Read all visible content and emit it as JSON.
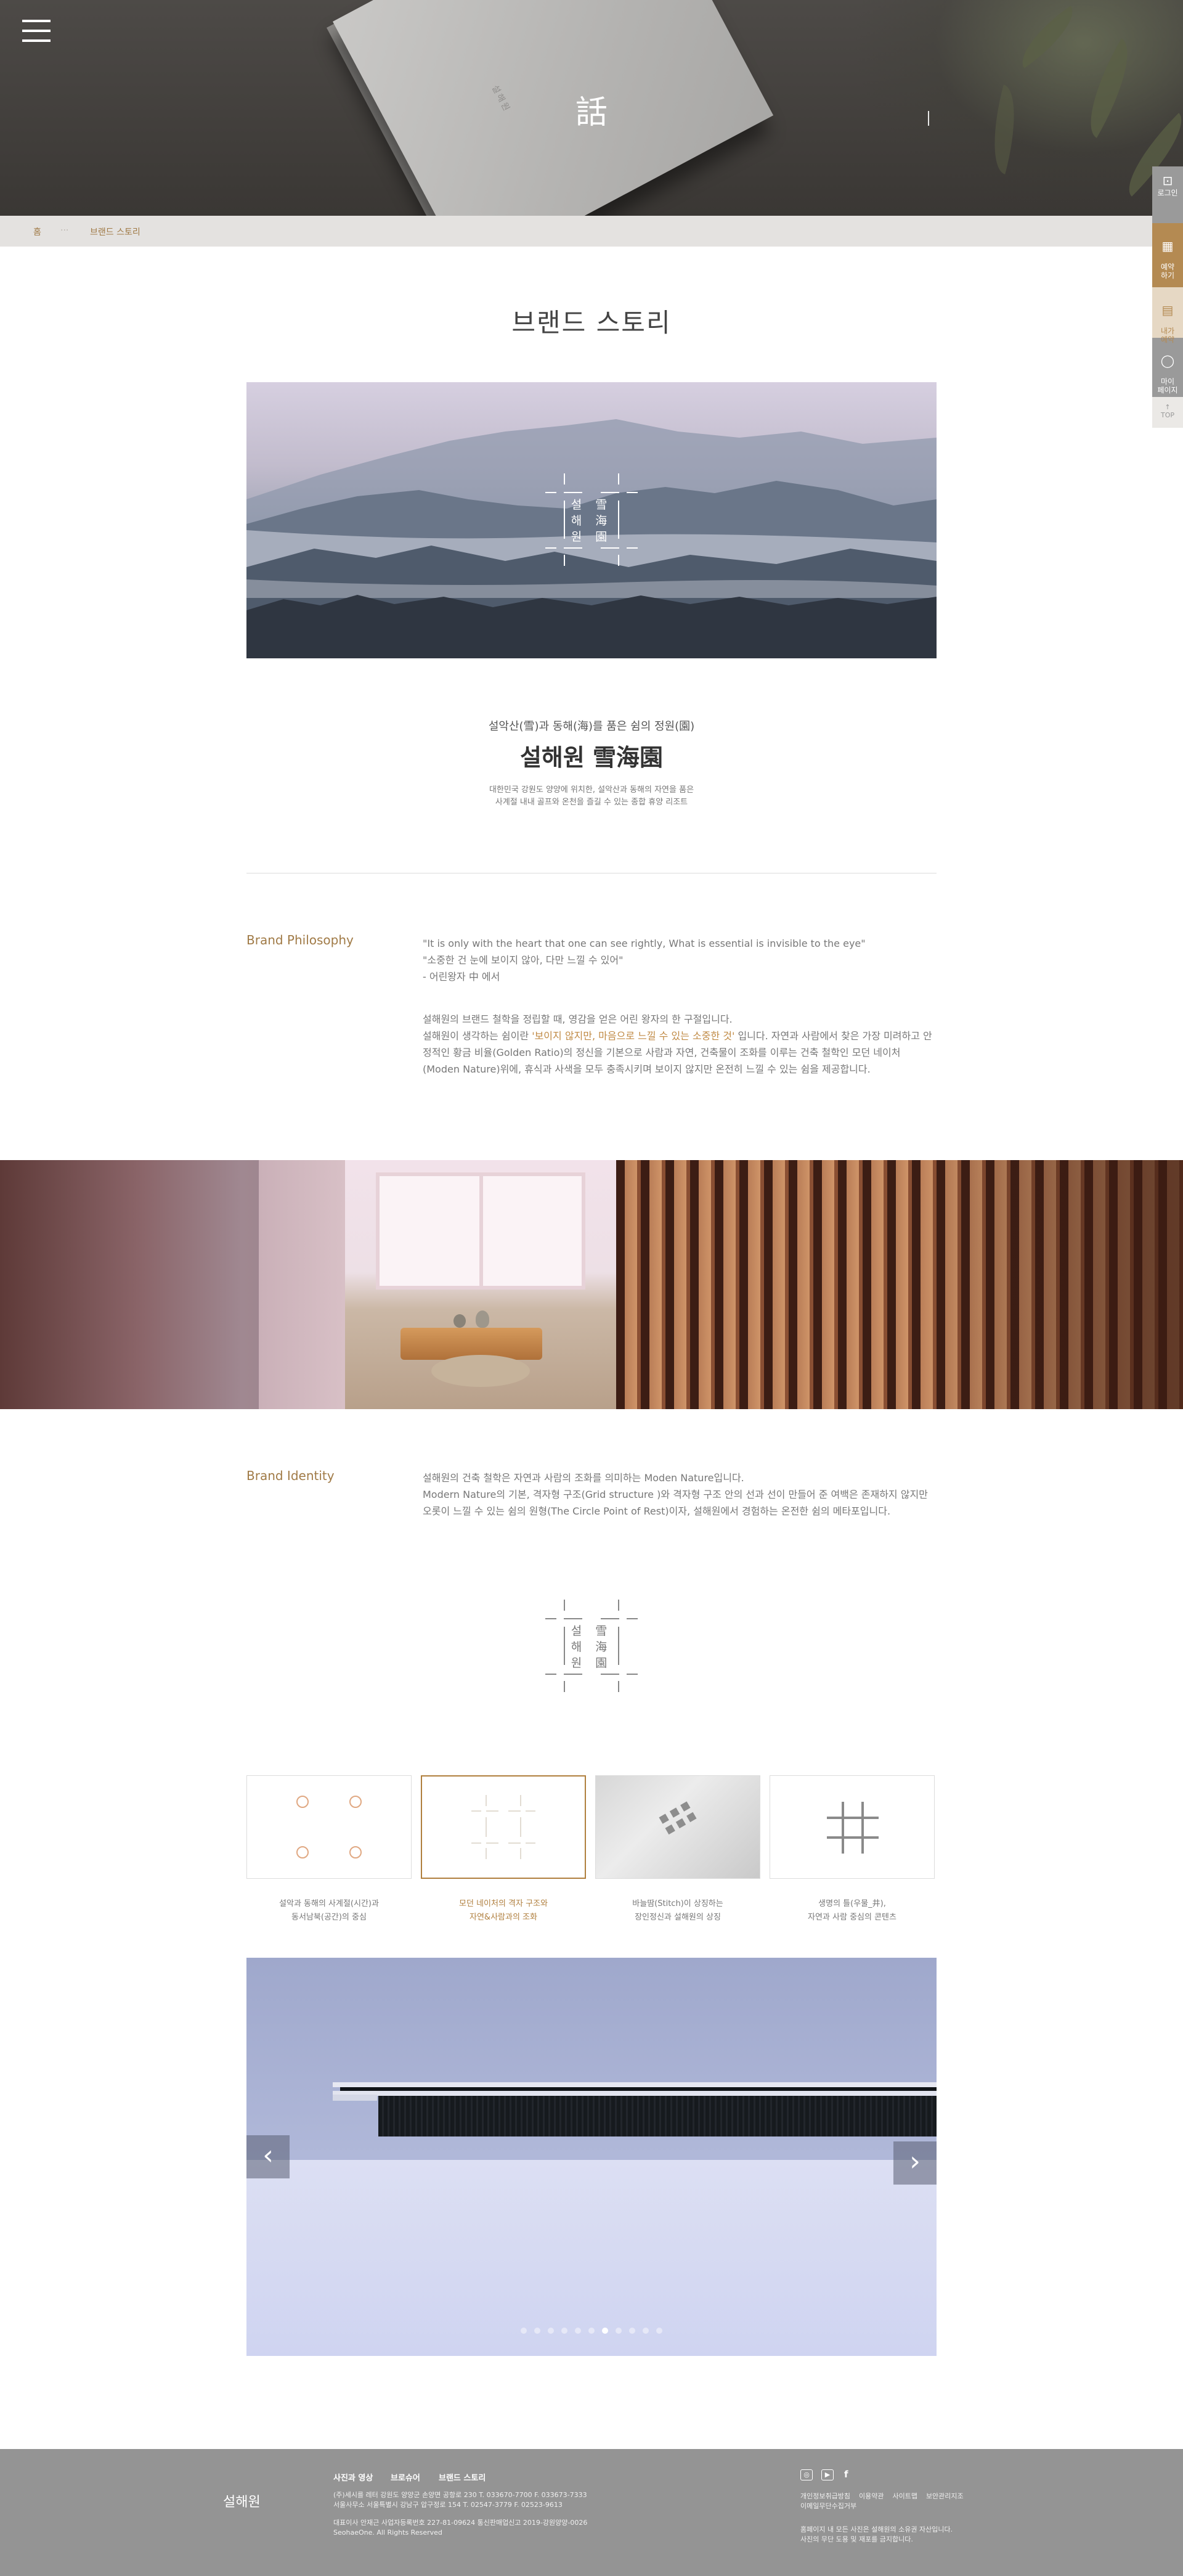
{
  "hero": {
    "character": "話",
    "book_text": "설해원"
  },
  "breadcrumb": {
    "home": "홈",
    "separator": "···",
    "current": "브랜드 스토리"
  },
  "side_menu": [
    {
      "label": "로그인",
      "icon": "login-icon",
      "color": "#9a9a9a"
    },
    {
      "label": "예약\n하기",
      "icon": "calendar-icon",
      "color": "#b48a52"
    },
    {
      "label": "내가\n예약",
      "icon": "reservation-check-icon",
      "color": "#e6d8c4"
    },
    {
      "label": "마이\n페이지",
      "icon": "user-icon",
      "color": "#9a9a9a"
    }
  ],
  "side_top": "TOP",
  "page_title": "브랜드 스토리",
  "logo": {
    "line1": "설 雪",
    "line2": "해 海",
    "line3": "원 園"
  },
  "intro": {
    "subheading": "설악산(雪)과 동해(海)를 품은 쉼의 정원(園)",
    "heading": "설해원 雪海園",
    "desc_line1": "대한민국 강원도 양양에 위치한, 설악산과 동해의 자연을 품은",
    "desc_line2": "사계절 내내 골프와 온천을 즐길 수 있는 종합 휴양 리조트"
  },
  "philosophy": {
    "label": "Brand Philosophy",
    "quote1": "\"It is only with the heart that one can see rightly, What is essential is invisible to the eye\"",
    "quote2": "\"소중한 건 눈에 보이지 않아, 다만 느낄 수 있어\"",
    "quote3": "- 어린왕자 中 에서",
    "p1": "설해원의 브랜드 철학을 정립할 때, 영감을 얻은 어린 왕자의 한 구절입니다.",
    "p2a": "설해원이 생각하는 쉼이란 ",
    "p2_highlight": "'보이지 않지만, 마음으로 느낄 수 있는 소중한 것'",
    "p2b": " 입니다. 자연과 사람에서 찾은 가장 미려하고 안정적인 황금 비율(Golden Ratio)의 정신을 기본으로 사람과 자연, 건축물이 조화를 이루는 건축 철학인 모던 네이처(Moden Nature)위에, 휴식과 사색을 모두 충족시키며 보이지 않지만 온전히 느낄 수 있는 쉼을 제공합니다."
  },
  "identity": {
    "label": "Brand Identity",
    "p1": "설해원의 건축 철학은 자연과 사람의 조화를 의미하는 Moden Nature입니다.",
    "p2": "Modern Nature의 기본, 격자형 구조(Grid structure )와 격자형 구조 안의 선과 선이 만들어 준 여백은 존재하지 않지만 오롯이 느낄 수 있는 쉼의 원형(The Circle Point of Rest)이자, 설해원에서 경험하는 온전한 쉼의 메타포입니다."
  },
  "cards": [
    {
      "line1": "설악과 동해의 사계절(시간)과",
      "line2": "동서남북(공간)의 중심",
      "icon": "four-circles-icon",
      "active": false
    },
    {
      "line1": "모던 네이처의 격자 구조와",
      "line2": "자연&사람과의 조화",
      "icon": "grid-lines-icon",
      "active": true
    },
    {
      "line1": "바늘땀(Stitch)이 상징하는",
      "line2": "장인정신과 설해원의 상징",
      "icon": "stitch-fabric-icon",
      "active": false
    },
    {
      "line1": "생명의 틀(우물_井),",
      "line2": "자연과 사람 중심의 콘텐츠",
      "icon": "well-grid-icon",
      "active": false
    }
  ],
  "slider": {
    "prev": "‹",
    "next": "›",
    "total": 11,
    "active_index": 6
  },
  "footer": {
    "logo": "설해원",
    "links": [
      "사진과 영상",
      "브로슈어",
      "브랜드 스토리"
    ],
    "addr1": "(주)세시를 레터    강원도 양양군 손양면 공항로 230    T. 033670-7700    F. 033673-7333",
    "addr2": "서울사무소 서울특별시 강남구 압구정로 154    T. 02547-3779    F. 02523-9613",
    "biz": "대표이사 안재근    사업자등록번호 227-81-09624    통신판매업신고 2019-강원양양-0026",
    "copyright": "SeohaeOne. All Rights Reserved",
    "policy_links": [
      "개인정보취급방침",
      "이용약관",
      "사이트맵",
      "이메일무단수집거부",
      "보안관리지조"
    ],
    "notice1": "홈페이지 내 모든 사진은 설해원의 소유권 자산입니다.",
    "notice2": "사진의 무단 도용 및 재포를 금지합니다."
  }
}
